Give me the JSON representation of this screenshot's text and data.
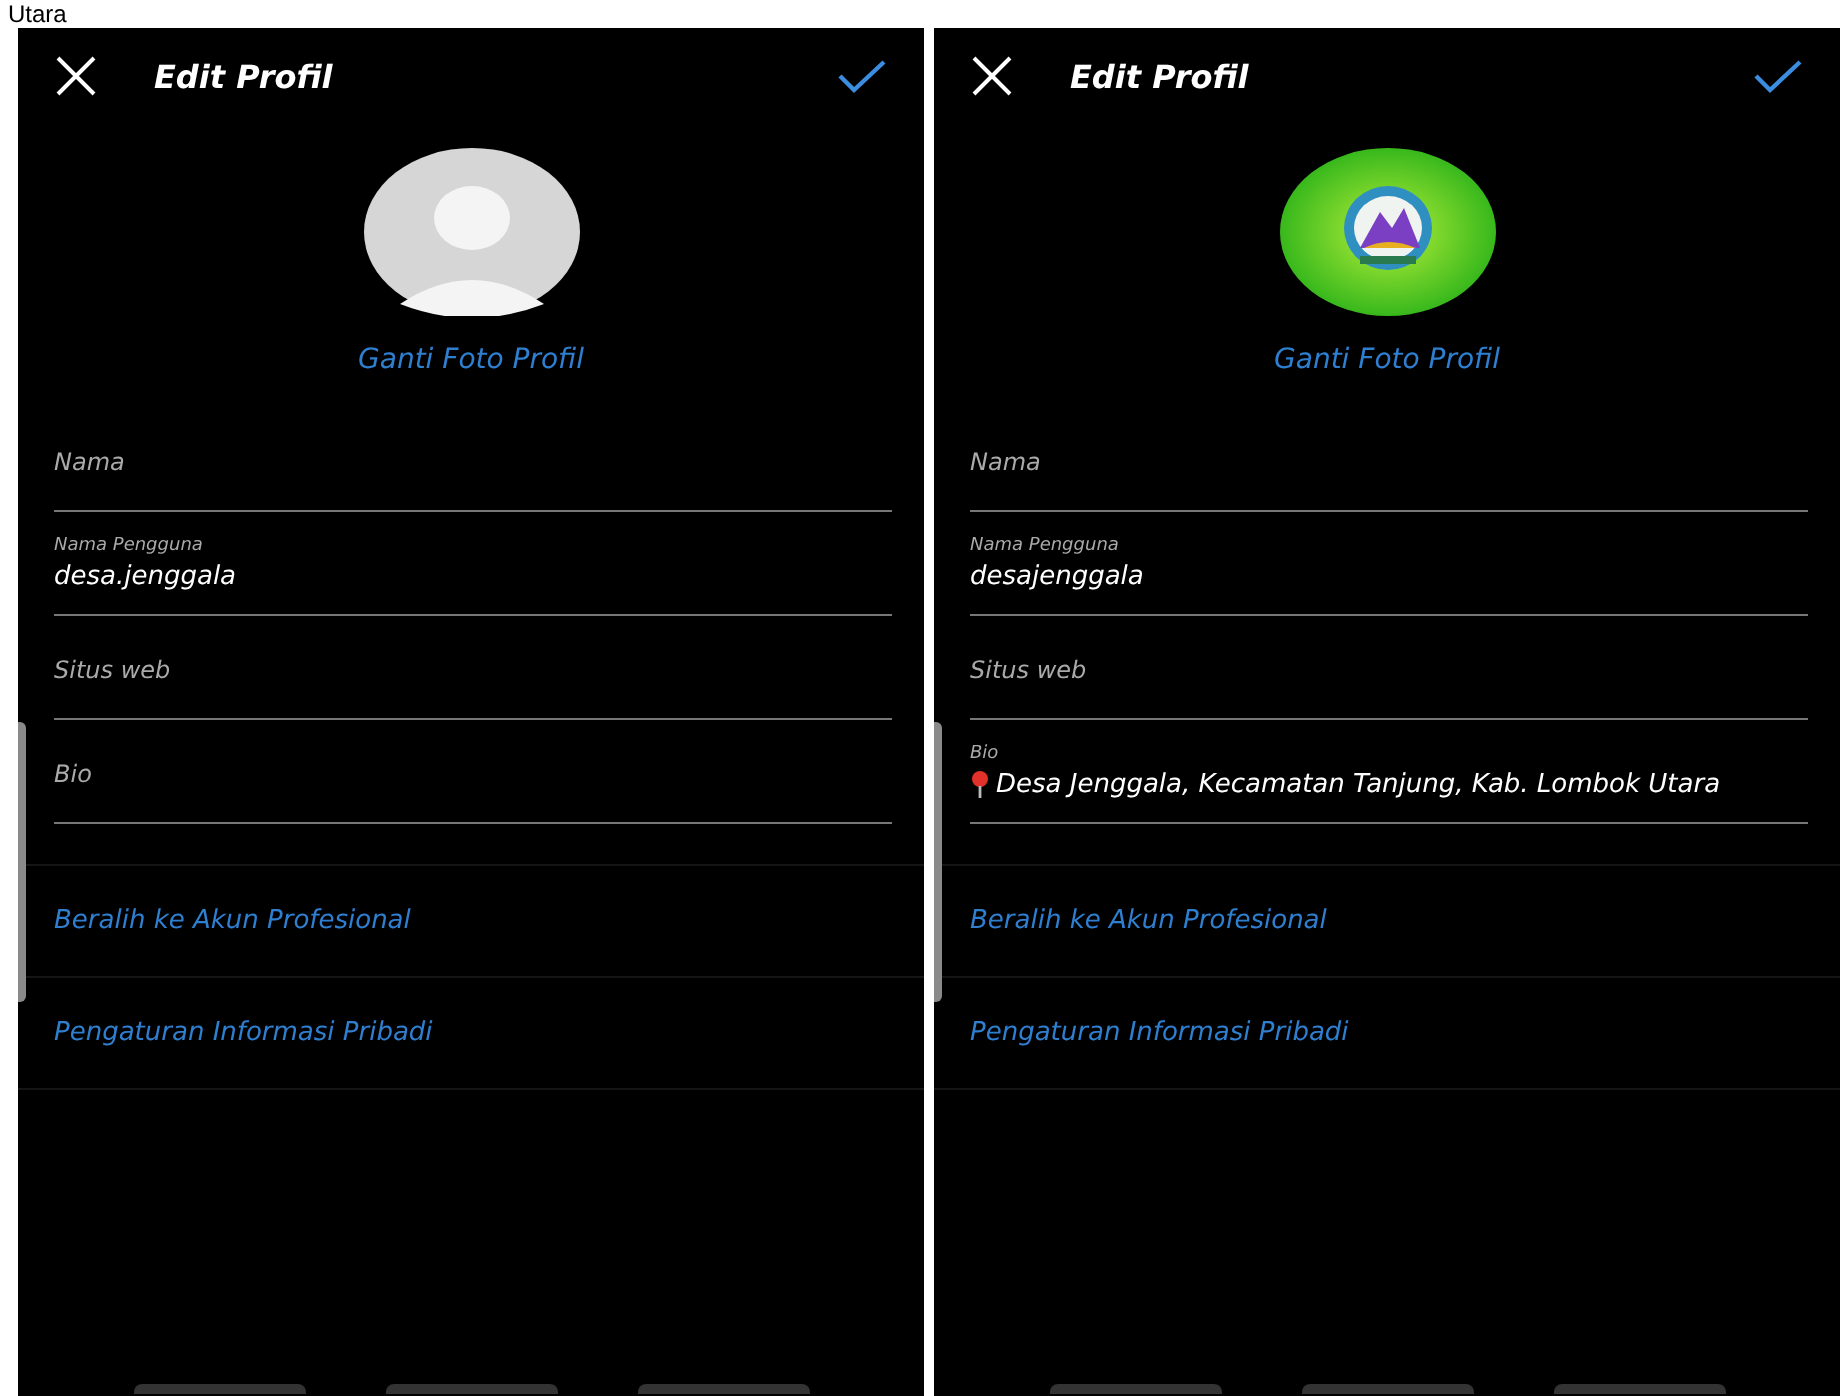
{
  "caption": "Utara",
  "panels": [
    {
      "title": "Edit Profil",
      "avatar": {
        "kind": "placeholder"
      },
      "change_photo": "Ganti Foto Profil",
      "fields": [
        {
          "label": "Nama",
          "pin": false
        },
        {
          "label": "Nama Pengguna",
          "value": "desa.jenggala",
          "pin": false
        },
        {
          "label": "Situs web",
          "pin": false
        },
        {
          "label": "Bio",
          "pin": false
        }
      ],
      "links": [
        "Beralih ke Akun Profesional",
        "Pengaturan Informasi Pribadi"
      ]
    },
    {
      "title": "Edit Profil",
      "avatar": {
        "kind": "logo"
      },
      "change_photo": "Ganti Foto Profil",
      "fields": [
        {
          "label": "Nama",
          "pin": false
        },
        {
          "label": "Nama Pengguna",
          "value": "desajenggala",
          "pin": false
        },
        {
          "label": "Situs web",
          "pin": false
        },
        {
          "label": "Bio",
          "value": "Desa Jenggala, Kecamatan Tanjung, Kab. Lombok Utara",
          "pin": true
        }
      ],
      "links": [
        "Beralih ke Akun Profesional",
        "Pengaturan Informasi Pribadi"
      ]
    }
  ]
}
